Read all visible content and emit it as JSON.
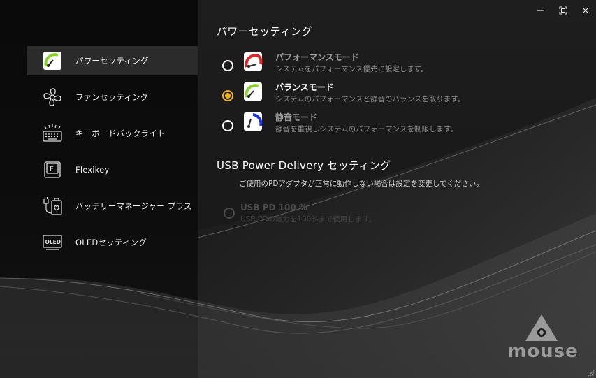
{
  "window": {
    "minimize_icon": "minimize-icon",
    "maximize_icon": "fullscreen-icon",
    "close_icon": "close-icon"
  },
  "sidebar": {
    "items": [
      {
        "label": "パワーセッティング",
        "icon": "power-gauge-icon",
        "active": true
      },
      {
        "label": "ファンセッティング",
        "icon": "fan-icon",
        "active": false
      },
      {
        "label": "キーボードバックライト",
        "icon": "keyboard-backlight-icon",
        "active": false
      },
      {
        "label": "Flexikey",
        "icon": "flexikey-icon",
        "active": false
      },
      {
        "label": "バッテリーマネージャー プラス",
        "icon": "battery-manager-icon",
        "active": false
      },
      {
        "label": "OLEDセッティング",
        "icon": "oled-icon",
        "active": false
      }
    ],
    "oled_icon_text": "OLED",
    "flexikey_icon_text": "F"
  },
  "power": {
    "heading": "パワーセッティング",
    "modes": [
      {
        "name": "パフォーマンスモード",
        "desc": "システムをパフォーマンス優先に設定します。",
        "selected": false,
        "gauge_color": "#e02424"
      },
      {
        "name": "バランスモード",
        "desc": "システムのパフォーマンスと静音のバランスを取ります。",
        "selected": true,
        "gauge_color": "#8bd12e"
      },
      {
        "name": "静音モード",
        "desc": "静音を重視しシステムのパフォーマンスを制限します。",
        "selected": false,
        "gauge_color": "#1a2fd6"
      }
    ]
  },
  "usb": {
    "heading": "USB Power Delivery セッティング",
    "note": "ご使用のPDアダプタが正常に動作しない場合は設定を変更してください。",
    "option_name": "USB PD 100 %",
    "option_desc": "USB PDの電力を100%まで使用します。",
    "enabled": false
  },
  "brand": {
    "text": "mouse"
  },
  "colors": {
    "accent": "#f2b01e",
    "active_bg": "#2b2b2b"
  }
}
